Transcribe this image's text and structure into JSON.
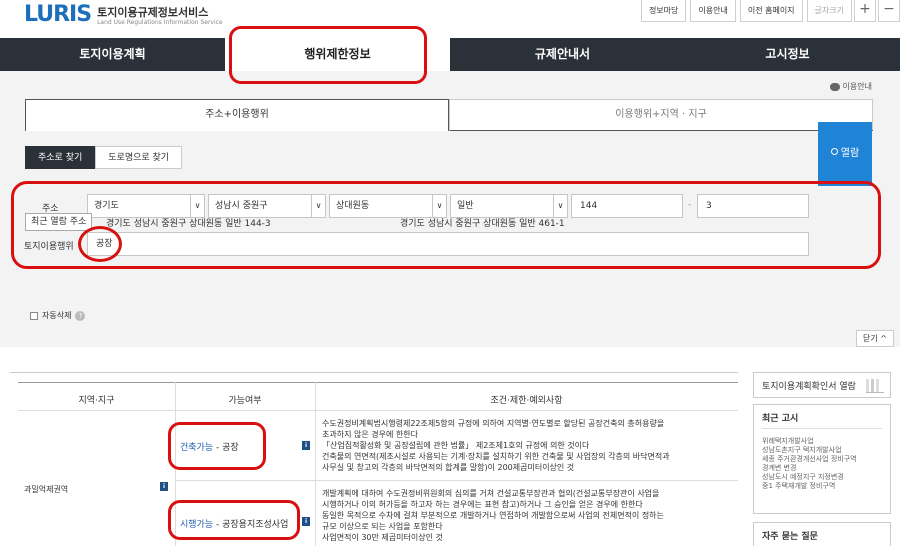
{
  "header": {
    "logo_mark": "LURIS",
    "logo_title": "토지이용규제정보서비스",
    "logo_sub": "Land Use Regulations Information Service",
    "links": [
      "정보마당",
      "이용안내",
      "이전 홈페이지",
      "글자크기"
    ],
    "zoom_in": "+",
    "zoom_out": "−"
  },
  "mainnav": {
    "tabs": [
      "토지이용계획",
      "행위제한정보",
      "규제안내서",
      "고시정보"
    ],
    "active_index": 1
  },
  "search": {
    "help_label": "이용안내",
    "subtabs": [
      "주소+이용행위",
      "이용행위+지역 · 지구"
    ],
    "mini_tabs": [
      "주소로 찾기",
      "도로명으로 찾기"
    ],
    "address_label": "주소",
    "province": "경기도",
    "city": "성남시 중원구",
    "dong": "상대원동",
    "land_type": "일반",
    "main_no": "144",
    "dash": "-",
    "sub_no": "3",
    "activity_label": "토지이용행위",
    "activity_value": "공장",
    "search_button": "열람",
    "recent_button": "최근 열람 주소",
    "recent_1": "경기도 성남시 중원구 상대원동 일반 144-3",
    "recent_2": "경기도 성남시 중원구 상대원동 일반 461-1",
    "auto_delete": "자동삭제",
    "close_label": "닫기"
  },
  "result": {
    "headers": [
      "지역·지구",
      "가능여부",
      "조건·제한·예외사항"
    ],
    "category": "과밀억제권역",
    "rows": [
      {
        "status": "건축가능",
        "item": "공장",
        "lines": [
          "수도권정비계획법시행령제22조제5항의 규정에 의하여 지역별·연도별로 할당된 공장건축의 총허용량을",
          "초과하지 않은 경우에 한한다",
          "「산업집적활성화 및 공장설립에 관한 법률」 제2조제1호의 규정에 의한 것이다",
          "건축물의 연면적(제조시설로 사용되는 기계·장치를 설치하기 위한 건축물 및 사업장의 각층의 바닥면적과",
          "사무실 및 창고의 각층의 바닥면적의 합계를 말함)이 200제곱미터이상인 것"
        ]
      },
      {
        "status": "시행가능",
        "item": "공장용지조성사업",
        "lines": [
          "개발계획에 대하여 수도권정비위원회의 심의를 거쳐 건설교통부장관과 협의(건설교통부장관이 사업을",
          "시행하거나 이의 허가등을 하고자 하는 경우에는 표현 참고)하거나 그 승인을 얻은 경우에 한한다",
          "동일한 목적으로 수차에 걸쳐 부분적으로 개발하거나 연접하여 개발함으로써 사업의 전체면적이 정하는",
          "규모 이상으로 되는 사업을 포함한다",
          "사업면적이 30만 제곱미터이상인 것"
        ]
      }
    ]
  },
  "sidebar": {
    "confirm_title": "토지이용계획확인서 열람",
    "notice_title": "최근 고시",
    "notices": [
      "위례택지개발사업",
      "성남도촌지구 택지개발사업",
      "세종 주거환경개선사업 정비구역",
      "경계변 변경",
      "성남도시 예정지구 지정변경",
      "중1 주택재개발 정비구역"
    ],
    "faq_title": "자주 묻는 질문"
  },
  "colors": {
    "nav_dark": "#2a3138",
    "accent_blue": "#1f84d6",
    "annotation_red": "#d81010"
  }
}
